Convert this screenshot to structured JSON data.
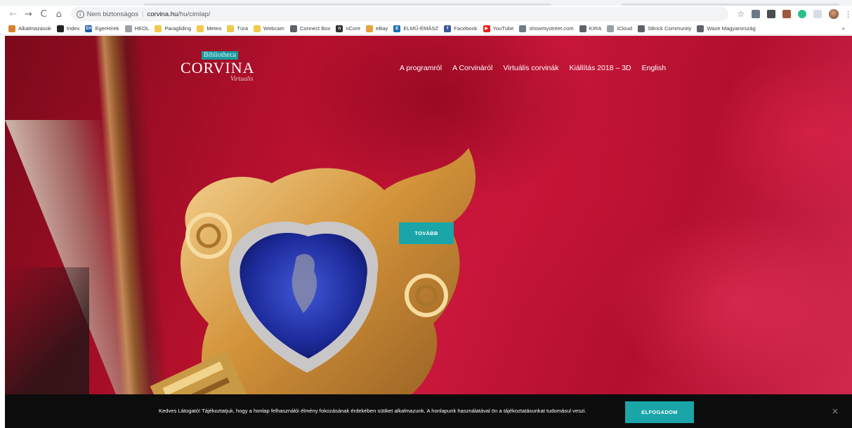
{
  "browser": {
    "nav": {
      "back_icon": "←",
      "forward_icon": "→",
      "reload_icon": "C",
      "home_icon": "⌂"
    },
    "address": {
      "security_text": "Nem biztonságos",
      "host": "corvina.hu",
      "path": "/hu/cimlap/"
    },
    "bookmarks": [
      {
        "label": "Alkalmazások",
        "color": "#d9822b",
        "glyph": ""
      },
      {
        "label": "Index",
        "color": "#222222",
        "glyph": ""
      },
      {
        "label": "EgerHírek",
        "color": "#1f5aa8",
        "glyph": "EH"
      },
      {
        "label": "HEOL",
        "color": "#9aa0a6",
        "glyph": ""
      },
      {
        "label": "Paragliding",
        "color": "#f2c94c",
        "glyph": ""
      },
      {
        "label": "Meteo",
        "color": "#f2c94c",
        "glyph": ""
      },
      {
        "label": "Túra",
        "color": "#f2c94c",
        "glyph": ""
      },
      {
        "label": "Webcam",
        "color": "#f2c94c",
        "glyph": ""
      },
      {
        "label": "Connect Box",
        "color": "#5f6368",
        "glyph": ""
      },
      {
        "label": "nCore",
        "color": "#333333",
        "glyph": "n"
      },
      {
        "label": "eBay",
        "color": "#e8a33d",
        "glyph": ""
      },
      {
        "label": "ELMŰ-ÉMÁSZ",
        "color": "#1f6fb2",
        "glyph": "E"
      },
      {
        "label": "Facebook",
        "color": "#3b5998",
        "glyph": "f"
      },
      {
        "label": "YouTube",
        "color": "#e62117",
        "glyph": "▶"
      },
      {
        "label": "showmystreet.com",
        "color": "#6f7b85",
        "glyph": ""
      },
      {
        "label": "KIRA",
        "color": "#5f6368",
        "glyph": ""
      },
      {
        "label": "iCloud",
        "color": "#9aa0a6",
        "glyph": ""
      },
      {
        "label": "SBrick Community",
        "color": "#5f6368",
        "glyph": ""
      },
      {
        "label": "Waze Magyarország",
        "color": "#5f6368",
        "glyph": ""
      }
    ],
    "bookmarks_more": "»"
  },
  "site": {
    "logo": {
      "tag": "Bibliotheca",
      "title": "CORVINA",
      "sub": "Virtualis"
    },
    "nav": [
      {
        "label": "A programról"
      },
      {
        "label": "A Corvináról"
      },
      {
        "label": "Virtuális corvinák"
      },
      {
        "label": "Kiállítás 2018 – 3D"
      },
      {
        "label": "English"
      }
    ],
    "cta_label": "TOVÁBB"
  },
  "cookie": {
    "text": "Kedves Látogató! Tájékoztatjuk, hogy a honlap felhasználói élmény fokozásának érdekében sütiket alkalmazunk. A honlapunk használatával ön a tájékoztatásunkat tudomásul veszi.",
    "accept_label": "ELFOGADOM",
    "close_glyph": "×"
  },
  "colors": {
    "accent": "#1aa5a8",
    "velvet": "#c8173a",
    "banner": "#0c0c0d"
  }
}
